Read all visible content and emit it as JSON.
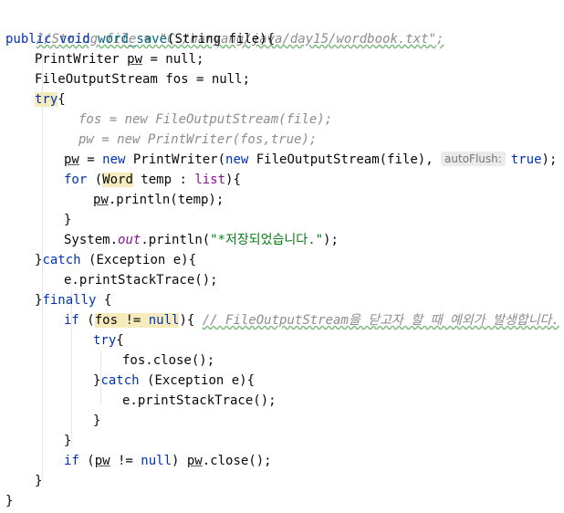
{
  "editor": {
    "c_path": "//String file = \"C:/haryang/java/day15/wordbook.txt\";",
    "c_comment": "// FileOutputStream을 닫고자 할 때 예외가 발생합니다.",
    "c_fos": "fos = new FileOutputStream(file);",
    "c_pw": "pw = new PrintWriter(fos,true);",
    "s_saved": "\"*저장되었습니다.\"",
    "hint_autoflush": "autoFlush:",
    "kw_public": "public",
    "kw_void": "void",
    "kw_try": "try",
    "kw_catch": "catch",
    "kw_finally": "finally",
    "kw_if": "if",
    "kw_for": "for",
    "kw_new": "new",
    "kw_null": "null",
    "kw_true": "true",
    "m_word_save": "word_save",
    "f_out": "out",
    "pw": "pw",
    "fos": "fos",
    "list": "list",
    "word": "Word",
    "t_decl_tail": "(String file){",
    "t_pw_decl_head": "PrintWriter ",
    "t_pw_decl_tail": " = null;",
    "t_fos_decl": "FileOutputStream fos = null;",
    "t_brace_open": "{",
    "t_assign_eq": " = ",
    "t_pw_ctor": " PrintWriter(",
    "t_fos_ctor": " FileOutputStream(file), ",
    "t_close_paren_semi": ");",
    "t_for_open": " (",
    "t_for_mid": " temp : ",
    "t_for_close": "){",
    "t_println_temp": ".println(temp);",
    "t_close_brace": "}",
    "t_sys": "System.",
    "t_println_open": ".println(",
    "t_exc_open": " (Exception e){",
    "t_print_stack": "e.printStackTrace();",
    "t_finally_tail": " {",
    "t_paren_open": " (",
    "t_neq": " != ",
    "t_if_close": "){ ",
    "t_fos_close": "fos.close();",
    "t_if_pw_close": ") ",
    "t_pw_close_call": ".close();"
  }
}
